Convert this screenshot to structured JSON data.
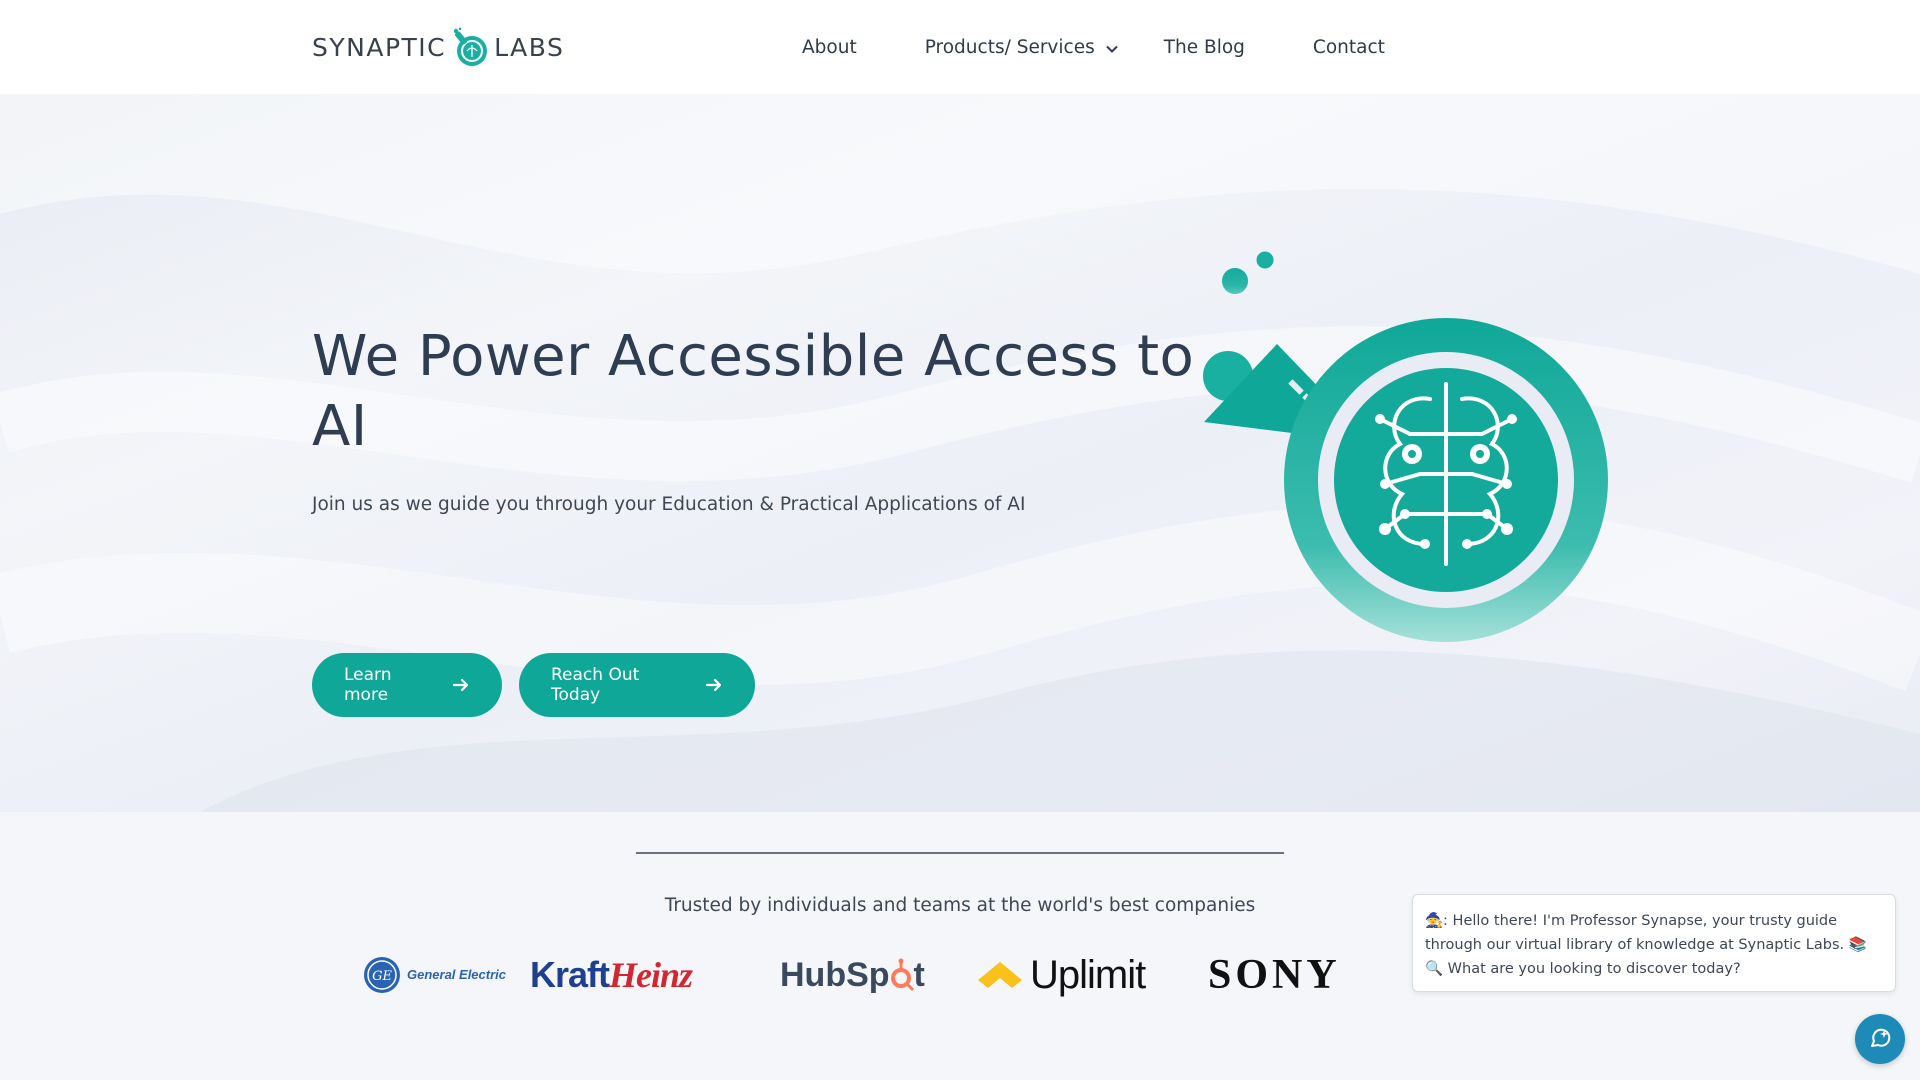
{
  "header": {
    "logo_left": "SYNAPTIC",
    "logo_right": "LABS",
    "nav": [
      {
        "label": "About"
      },
      {
        "label": "Products/ Services",
        "has_dropdown": true
      },
      {
        "label": "The Blog"
      },
      {
        "label": "Contact"
      }
    ]
  },
  "hero": {
    "title": "We Power Accessible Access to AI",
    "subtitle": "Join us as we guide you through your Education & Practical Applications of AI",
    "buttons": [
      {
        "label": "Learn more"
      },
      {
        "label": "Reach Out Today"
      }
    ]
  },
  "trusted": {
    "text": "Trusted by individuals and teams at the world's best companies",
    "brands": [
      "General Electric",
      "KraftHeinz",
      "HubSpot",
      "Uplimit",
      "SONY"
    ]
  },
  "chat": {
    "message": "🧙: Hello there! I'm Professor Synapse, your trusty guide through our virtual library of knowledge at Synaptic Labs. 📚🔍 What are you looking to discover today?"
  },
  "colors": {
    "accent": "#0fa898",
    "text_dark": "#2f3d52",
    "chat_fab": "#1e8ab8"
  }
}
